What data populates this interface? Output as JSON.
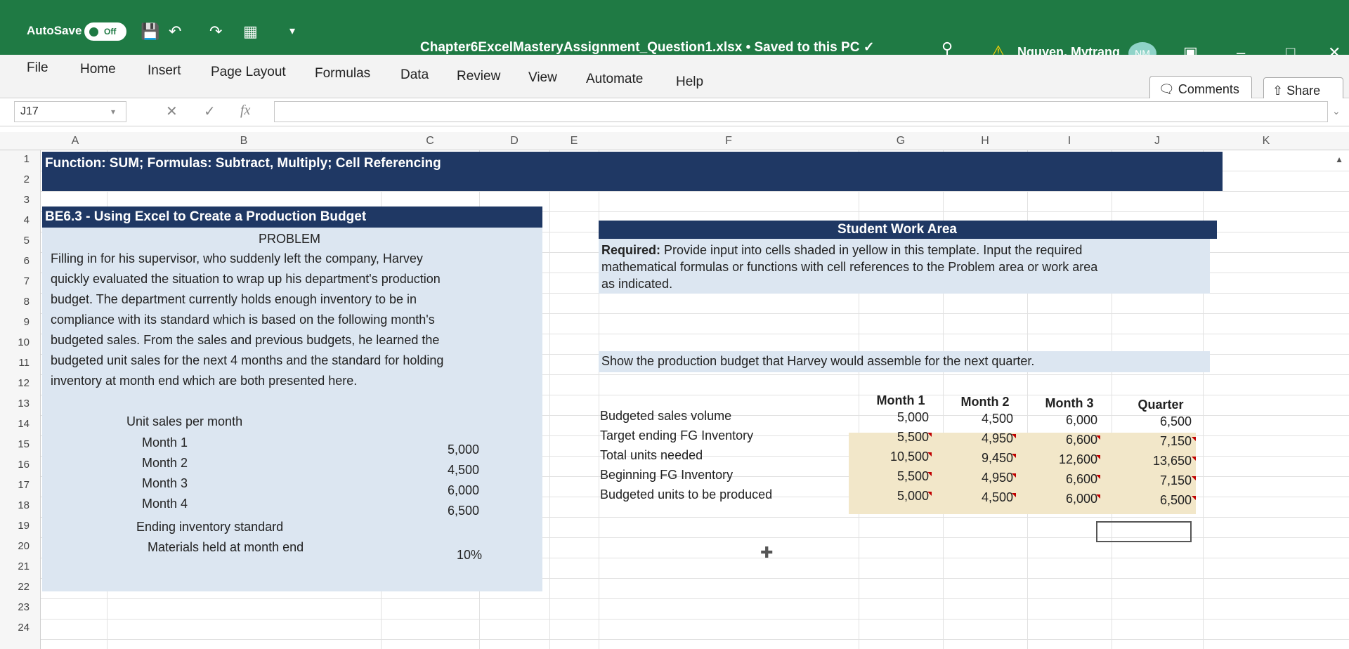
{
  "titlebar": {
    "autosave_label": "AutoSave",
    "autosave_state": "Off",
    "doc_title": "Chapter6ExcelMasteryAssignment_Question1.xlsx • Saved to this PC ✓",
    "user_name": "Nguyen, Mytrang",
    "user_initials": "NM"
  },
  "ribbon": {
    "tabs": [
      "File",
      "Home",
      "Insert",
      "Page Layout",
      "Formulas",
      "Data",
      "Review",
      "View",
      "Automate",
      "Help"
    ],
    "comments_label": "Comments",
    "share_label": "Share"
  },
  "formula_bar": {
    "name_box": "J17",
    "fx": "fx",
    "value": ""
  },
  "columns": [
    "A",
    "B",
    "C",
    "D",
    "E",
    "F",
    "G",
    "H",
    "I",
    "J",
    "K"
  ],
  "rows": [
    "1",
    "2",
    "3",
    "4",
    "5",
    "6",
    "7",
    "8",
    "9",
    "10",
    "11",
    "12",
    "13",
    "14",
    "15",
    "16",
    "17",
    "18",
    "19",
    "20",
    "21",
    "22",
    "23",
    "24"
  ],
  "sheet": {
    "row1_title": "Function: SUM; Formulas: Subtract, Multiply; Cell Referencing",
    "problem_title": "BE6.3 - Using Excel to Create a Production Budget",
    "problem_label": "PROBLEM",
    "problem_lines": [
      "Filling in for his supervisor, who suddenly left the company, Harvey",
      "quickly evaluated the situation to wrap up his department's production",
      "budget. The department currently holds enough inventory to be in",
      "compliance with its standard which is based on the following month's",
      "budgeted sales. From the sales and previous budgets, he learned the",
      "budgeted unit sales for the next 4 months and the standard for holding",
      "inventory at month end which are both presented here."
    ],
    "unit_sales_label": "Unit sales per month",
    "months": [
      {
        "label": "Month 1",
        "value": "5,000"
      },
      {
        "label": "Month 2",
        "value": "4,500"
      },
      {
        "label": "Month 3",
        "value": "6,000"
      },
      {
        "label": "Month 4",
        "value": "6,500"
      }
    ],
    "ending_inventory_label": "Ending inventory standard",
    "materials_label": "Materials held at month end",
    "materials_value": "10%",
    "work_area_title": "Student Work Area",
    "required_bold": "Required:",
    "required_lines": [
      " Provide input into cells shaded in yellow in this template. Input the required",
      "mathematical formulas or functions with cell references to the Problem area or work area",
      "as indicated."
    ],
    "show_text": "Show the production budget that Harvey would assemble for the next quarter.",
    "budget_headers": [
      "Month 1",
      "Month 2",
      "Month 3",
      "Quarter"
    ],
    "budget_rows": [
      {
        "label": "Budgeted sales volume",
        "values": [
          "5,000",
          "4,500",
          "6,000",
          "6,500"
        ]
      },
      {
        "label": "Target ending FG Inventory",
        "values": [
          "5,500",
          "4,950",
          "6,600",
          "7,150"
        ]
      },
      {
        "label": "Total units needed",
        "values": [
          "10,500",
          "9,450",
          "12,600",
          "13,650"
        ]
      },
      {
        "label": "Beginning FG Inventory",
        "values": [
          "5,500",
          "4,950",
          "6,600",
          "7,150"
        ]
      },
      {
        "label": "Budgeted units to be produced",
        "values": [
          "5,000",
          "4,500",
          "6,000",
          "6,500"
        ]
      }
    ]
  }
}
